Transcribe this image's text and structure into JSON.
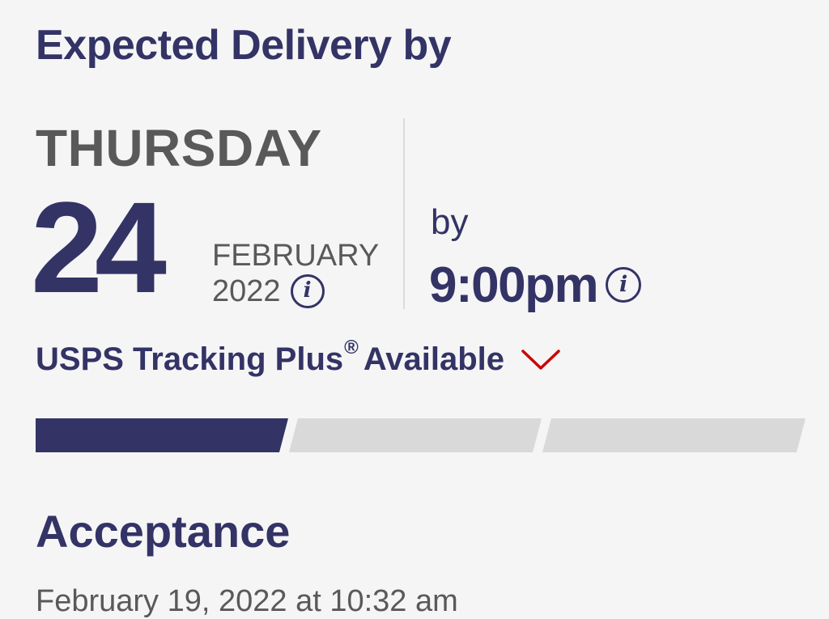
{
  "delivery": {
    "heading": "Expected Delivery by",
    "weekday": "THURSDAY",
    "day": "24",
    "month": "FEBRUARY",
    "year": "2022",
    "by_label": "by",
    "time": "9:00pm"
  },
  "tracking_plus": {
    "label": "USPS Tracking Plus",
    "mark": "®",
    "suffix": "Available",
    "icon": "chevron-down-icon",
    "color": "#cc0000"
  },
  "progress": {
    "steps_total": 3,
    "steps_completed": 1,
    "active_color": "#333366",
    "inactive_color": "#d9d9d9"
  },
  "event": {
    "status": "Acceptance",
    "timestamp": "February 19, 2022 at 10:32 am"
  },
  "colors": {
    "primary": "#333366",
    "secondary_text": "#595959",
    "background": "#f5f5f6"
  }
}
